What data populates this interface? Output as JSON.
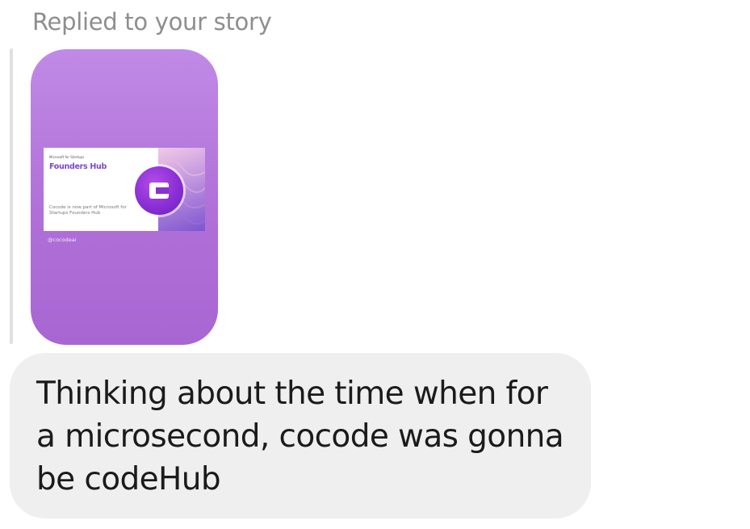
{
  "reply_header": {
    "label": "Replied to your story"
  },
  "story": {
    "card_brand": "Microsoft for Startups",
    "card_title": "Founders Hub",
    "card_description": "Cocode is now part of Microsoft for Startups Founders Hub",
    "logo_letter": "C",
    "caption": "@cocodeai",
    "colors": {
      "background_top": "#c18ae6",
      "background_bottom": "#a866d2",
      "logo": "#8a2fd6",
      "title": "#7b48c9"
    }
  },
  "message": {
    "text": "Thinking about the time when for a microsecond, cocode was gonna be codeHub",
    "bubble_color": "#efefef"
  }
}
